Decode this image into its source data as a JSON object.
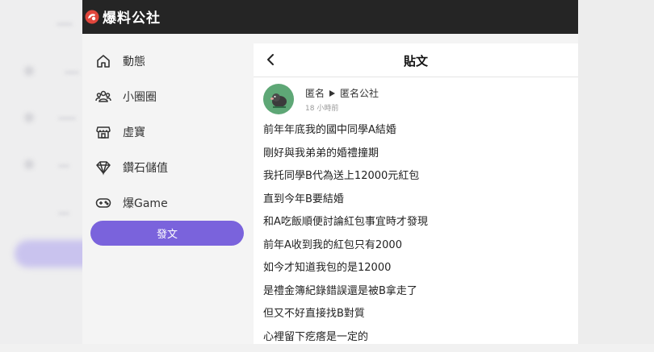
{
  "app": {
    "title": "爆料公社"
  },
  "nav": {
    "items": [
      {
        "label": "動態",
        "icon": "home-icon"
      },
      {
        "label": "小圈圈",
        "icon": "group-icon"
      },
      {
        "label": "虛寶",
        "icon": "store-icon"
      },
      {
        "label": "鑽石儲值",
        "icon": "diamond-icon"
      },
      {
        "label": "爆Game",
        "icon": "gamepad-icon"
      }
    ],
    "post_button": "發文"
  },
  "content": {
    "title": "貼文",
    "author": "匿名",
    "board": "匿名公社",
    "time": "18 小時前",
    "lines": [
      "前年年底我的國中同學A結婚",
      "剛好與我弟弟的婚禮撞期",
      "我托同學B代為送上12000元紅包",
      "直到今年B要結婚",
      "和A吃飯順便討論紅包事宜時才發現",
      "前年A收到我的紅包只有2000",
      "如今才知道我包的是12000",
      "是禮金簿紀錄錯誤還是被B拿走了",
      "但又不好直接找B對質",
      "心裡留下疙瘩是一定的"
    ]
  },
  "colors": {
    "topbar": "#252525",
    "accent": "#7a63dc",
    "avatar": "#5ea776"
  }
}
